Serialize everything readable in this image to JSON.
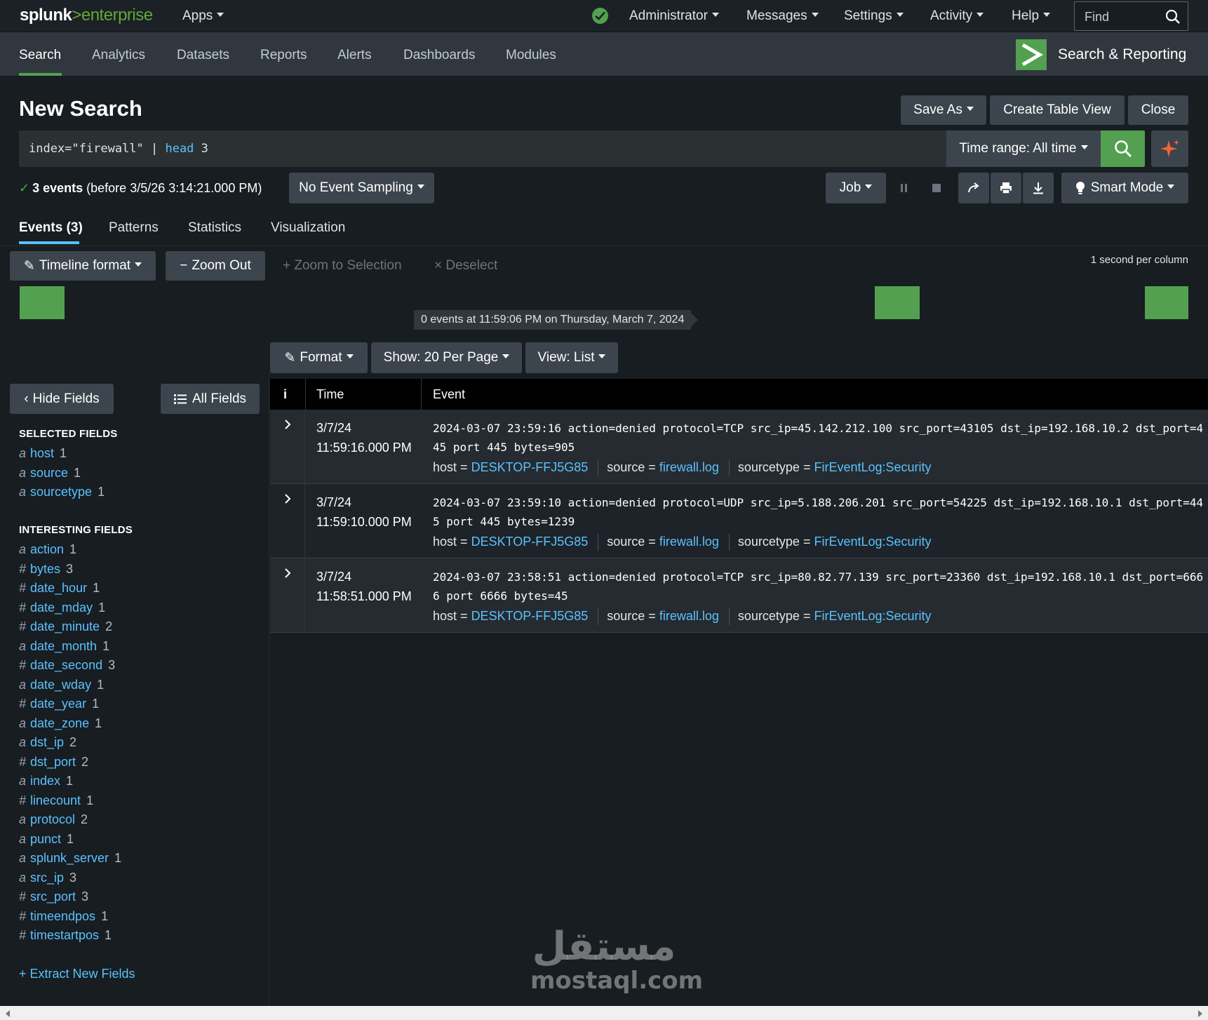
{
  "topbar": {
    "logo_main": "splunk",
    "logo_gt": ">",
    "logo_sub": "enterprise",
    "apps": "Apps",
    "user": "Administrator",
    "messages": "Messages",
    "settings": "Settings",
    "activity": "Activity",
    "help": "Help",
    "find_placeholder": "Find",
    "status_icon": "check-circle-icon"
  },
  "appbar": {
    "tabs": [
      "Search",
      "Analytics",
      "Datasets",
      "Reports",
      "Alerts",
      "Dashboards",
      "Modules"
    ],
    "active_tab": "Search",
    "app_name": "Search & Reporting"
  },
  "search": {
    "title": "New Search",
    "save_as": "Save As",
    "create_table_view": "Create Table View",
    "close": "Close",
    "query_prefix": "index=\"firewall\" | ",
    "query_command": "head",
    "query_suffix": " 3",
    "time_range": "Time range: All time",
    "events_count": "3 events",
    "events_range": "(before 3/5/26 3:14:21.000 PM)",
    "sampling": "No Event Sampling",
    "job": "Job",
    "mode": "Smart Mode"
  },
  "result_tabs": [
    "Events (3)",
    "Patterns",
    "Statistics",
    "Visualization"
  ],
  "timeline": {
    "format": "Timeline format",
    "zoom_out": "Zoom Out",
    "zoom_to_selection": "Zoom to Selection",
    "deselect": "Deselect",
    "scale": "1 second per column",
    "tooltip": "0 events at 11:59:06 PM on Thursday, March 7, 2024",
    "bar_color": "#53a051"
  },
  "results_toolbar": {
    "format": "Format",
    "per_page": "Show: 20 Per Page",
    "view": "View: List"
  },
  "fields": {
    "hide": "Hide Fields",
    "all": "All Fields",
    "selected_header": "SELECTED FIELDS",
    "selected": [
      {
        "type": "a",
        "name": "host",
        "count": "1"
      },
      {
        "type": "a",
        "name": "source",
        "count": "1"
      },
      {
        "type": "a",
        "name": "sourcetype",
        "count": "1"
      }
    ],
    "interesting_header": "INTERESTING FIELDS",
    "interesting": [
      {
        "type": "a",
        "name": "action",
        "count": "1"
      },
      {
        "type": "#",
        "name": "bytes",
        "count": "3"
      },
      {
        "type": "#",
        "name": "date_hour",
        "count": "1"
      },
      {
        "type": "#",
        "name": "date_mday",
        "count": "1"
      },
      {
        "type": "#",
        "name": "date_minute",
        "count": "2"
      },
      {
        "type": "a",
        "name": "date_month",
        "count": "1"
      },
      {
        "type": "#",
        "name": "date_second",
        "count": "3"
      },
      {
        "type": "a",
        "name": "date_wday",
        "count": "1"
      },
      {
        "type": "#",
        "name": "date_year",
        "count": "1"
      },
      {
        "type": "a",
        "name": "date_zone",
        "count": "1"
      },
      {
        "type": "a",
        "name": "dst_ip",
        "count": "2"
      },
      {
        "type": "#",
        "name": "dst_port",
        "count": "2"
      },
      {
        "type": "a",
        "name": "index",
        "count": "1"
      },
      {
        "type": "#",
        "name": "linecount",
        "count": "1"
      },
      {
        "type": "a",
        "name": "protocol",
        "count": "2"
      },
      {
        "type": "a",
        "name": "punct",
        "count": "1"
      },
      {
        "type": "a",
        "name": "splunk_server",
        "count": "1"
      },
      {
        "type": "a",
        "name": "src_ip",
        "count": "3"
      },
      {
        "type": "#",
        "name": "src_port",
        "count": "3"
      },
      {
        "type": "#",
        "name": "timeendpos",
        "count": "1"
      },
      {
        "type": "#",
        "name": "timestartpos",
        "count": "1"
      }
    ],
    "extract": "+ Extract New Fields"
  },
  "table": {
    "col_info": "i",
    "col_time": "Time",
    "col_event": "Event",
    "meta_labels": {
      "host": "host =",
      "source": "source =",
      "sourcetype": "sourcetype ="
    },
    "rows": [
      {
        "date": "3/7/24",
        "time": "11:59:16.000 PM",
        "raw": "2024-03-07 23:59:16 action=denied protocol=TCP src_ip=45.142.212.100 src_port=43105 dst_ip=192.168.10.2 dst_port=445 port 445 bytes=905",
        "host": "DESKTOP-FFJ5G85",
        "source": "firewall.log",
        "sourcetype": "FirEventLog:Security"
      },
      {
        "date": "3/7/24",
        "time": "11:59:10.000 PM",
        "raw": "2024-03-07 23:59:10 action=denied protocol=UDP src_ip=5.188.206.201 src_port=54225 dst_ip=192.168.10.1 dst_port=445 port 445 bytes=1239",
        "host": "DESKTOP-FFJ5G85",
        "source": "firewall.log",
        "sourcetype": "FirEventLog:Security"
      },
      {
        "date": "3/7/24",
        "time": "11:58:51.000 PM",
        "raw": "2024-03-07 23:58:51 action=denied protocol=TCP src_ip=80.82.77.139 src_port=23360 dst_ip=192.168.10.1 dst_port=6666 port 6666 bytes=45",
        "host": "DESKTOP-FFJ5G85",
        "source": "firewall.log",
        "sourcetype": "FirEventLog:Security"
      }
    ]
  },
  "watermark": {
    "glyph": "مستقل",
    "text": "mostaql.com"
  }
}
